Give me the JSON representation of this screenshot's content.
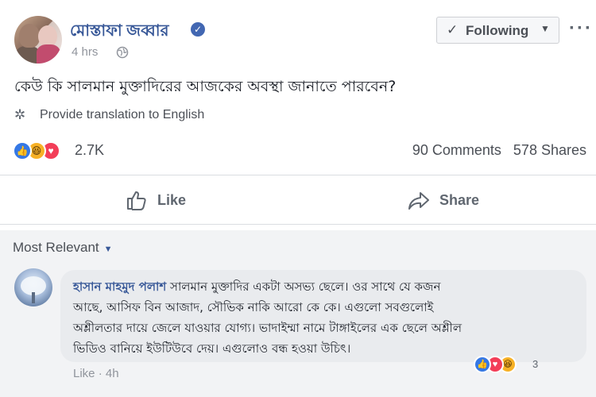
{
  "post": {
    "author": "মোস্তাফা জব্বার",
    "time": "4 hrs",
    "follow_label": "Following",
    "text": "কেউ কি সালমান মুক্তাদিরের আজকের অবস্থা জানাতে পারবেন?",
    "translate_label": "Provide translation to English",
    "reaction_count": "2.7K",
    "comments_label": "90 Comments",
    "shares_label": "578 Shares",
    "reaction_types": [
      "like",
      "haha",
      "love"
    ],
    "actions": {
      "like_label": "Like",
      "share_label": "Share"
    }
  },
  "comments_section": {
    "sort_label": "Most Relevant",
    "comment": {
      "author": "হাসান মাহমুদ পলাশ",
      "lines": [
        "সালমান মুক্তাদির একটা অসভ্য ছেলে। ওর সাথে যে কজন",
        "আছে, আসিফ বিন আজাদ, সৌভিক নাকি আরো কে কে। এগুলো সবগুলোই",
        "অশ্লীলতার দায়ে জেলে যাওয়ার যোগ্য। ভাদাইম্মা নামে টাঙ্গাইলের এক ছেলে অশ্লীল",
        "ভিডিও বানিয়ে ইউটিউবে দেয়। এগুলোও বন্ধ হওয়া উচিৎ।"
      ],
      "like_label": "Like",
      "dot": "·",
      "time": "4h",
      "reaction_count": "3",
      "reaction_types": [
        "like",
        "love",
        "haha"
      ]
    }
  },
  "colors": {
    "link": "#385898",
    "like_blue": "#3578e5",
    "love_red": "#f33e58",
    "haha_yellow": "#f7b125"
  }
}
